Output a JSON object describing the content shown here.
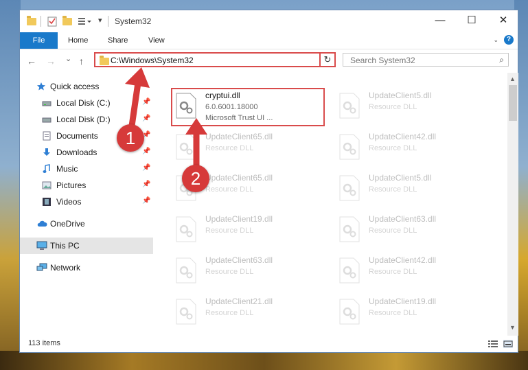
{
  "window": {
    "title": "System32"
  },
  "ribbon": {
    "tabs": [
      "File",
      "Home",
      "Share",
      "View"
    ],
    "help": "?"
  },
  "controls": {
    "minimize": "—",
    "maximize": "☐",
    "close": "✕"
  },
  "nav": {
    "back": "←",
    "forward": "→",
    "recent": "⌄",
    "up": "↑",
    "address": "C:\\Windows\\System32",
    "address_dropdown": "⌄",
    "refresh": "↻",
    "search_placeholder": "Search System32",
    "search_icon": "⌕"
  },
  "sidebar": {
    "items": [
      {
        "label": "Quick access",
        "icon": "star-icon",
        "pinned": false
      },
      {
        "label": "Local Disk (C:)",
        "icon": "drive-icon",
        "pinned": true
      },
      {
        "label": "Local Disk (D:)",
        "icon": "drive-icon",
        "pinned": true
      },
      {
        "label": "Documents",
        "icon": "documents-icon",
        "pinned": true
      },
      {
        "label": "Downloads",
        "icon": "download-icon",
        "pinned": true
      },
      {
        "label": "Music",
        "icon": "music-icon",
        "pinned": true
      },
      {
        "label": "Pictures",
        "icon": "pictures-icon",
        "pinned": true
      },
      {
        "label": "Videos",
        "icon": "videos-icon",
        "pinned": true
      },
      {
        "label": "OneDrive",
        "icon": "cloud-icon",
        "pinned": false
      },
      {
        "label": "This PC",
        "icon": "computer-icon",
        "pinned": false
      },
      {
        "label": "Network",
        "icon": "network-icon",
        "pinned": false
      }
    ],
    "pin_glyph": "📌"
  },
  "files": [
    {
      "name": "cryptui.dll",
      "version": "6.0.6001.18000",
      "description": "Microsoft Trust UI ..."
    },
    {
      "name": "UpdateClient5.dll",
      "description": "Resource DLL"
    },
    {
      "name": "UpdateClient65.dll",
      "description": "Resource DLL"
    },
    {
      "name": "UpdateClient42.dll",
      "description": "Resource DLL"
    },
    {
      "name": "UpdateClient65.dll",
      "description": "Resource DLL"
    },
    {
      "name": "UpdateClient5.dll",
      "description": "Resource DLL"
    },
    {
      "name": "UpdateClient19.dll",
      "description": "Resource DLL"
    },
    {
      "name": "UpdateClient63.dll",
      "description": "Resource DLL"
    },
    {
      "name": "UpdateClient63.dll",
      "description": "Resource DLL"
    },
    {
      "name": "UpdateClient42.dll",
      "description": "Resource DLL"
    },
    {
      "name": "UpdateClient21.dll",
      "description": "Resource DLL"
    },
    {
      "name": "UpdateClient19.dll",
      "description": "Resource DLL"
    }
  ],
  "status": {
    "item_count": "113 items"
  },
  "annotations": {
    "step1": "1",
    "step2": "2",
    "color": "#d63a3a"
  }
}
